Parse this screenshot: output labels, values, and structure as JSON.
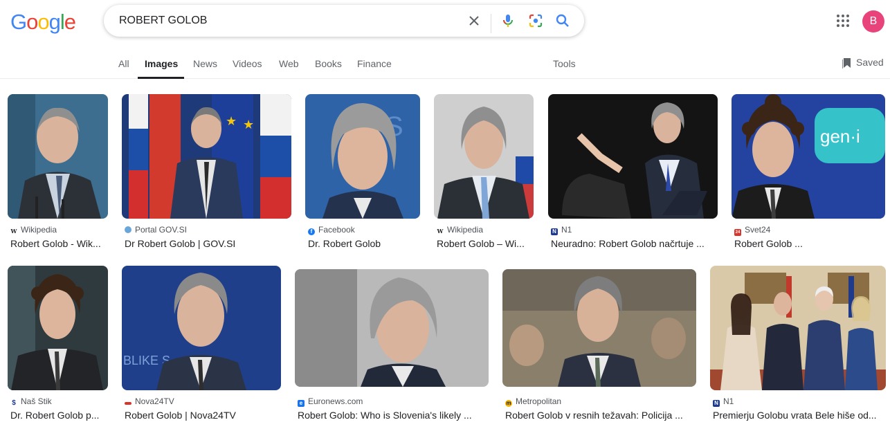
{
  "logo": {
    "letters": [
      "G",
      "o",
      "o",
      "g",
      "l",
      "e"
    ],
    "colors": [
      "#4285F4",
      "#EA4335",
      "#FBBC05",
      "#4285F4",
      "#34A853",
      "#EA4335"
    ]
  },
  "search": {
    "query": "ROBERT GOLOB"
  },
  "account": {
    "initial": "B",
    "color": "#e8437a"
  },
  "tabs": [
    "All",
    "Images",
    "News",
    "Videos",
    "Web",
    "Books",
    "Finance"
  ],
  "active_tab": "Images",
  "tools_label": "Tools",
  "saved_label": "Saved",
  "results": [
    {
      "source": "Wikipedia",
      "title": "Robert Golob - Wik...",
      "favicon": "W",
      "favcolor": "#ffffff"
    },
    {
      "source": "Portal GOV.SI",
      "title": "Dr Robert Golob | GOV.SI",
      "favicon": "",
      "favcolor": "#6aa7d8"
    },
    {
      "source": "Facebook",
      "title": "Dr. Robert Golob",
      "favicon": "f",
      "favcolor": "#1877f2"
    },
    {
      "source": "Wikipedia",
      "title": "Robert Golob – Wi...",
      "favicon": "W",
      "favcolor": "#ffffff"
    },
    {
      "source": "N1",
      "title": "Neuradno: Robert Golob načrtuje ...",
      "favicon": "N",
      "favcolor": "#1f3a8a"
    },
    {
      "source": "Svet24",
      "title": "Robert Golob ...",
      "favicon": "24",
      "favcolor": "#d9342b"
    },
    {
      "source": "Naš Stik",
      "title": "Dr. Robert Golob p...",
      "favicon": "$",
      "favcolor": "#ffffff"
    },
    {
      "source": "Nova24TV",
      "title": "Robert Golob | Nova24TV",
      "favicon": "",
      "favcolor": "#d9342b"
    },
    {
      "source": "Euronews.com",
      "title": "Robert Golob: Who is Slovenia's likely ...",
      "favicon": "e",
      "favcolor": "#1a73e8"
    },
    {
      "source": "Metropolitan",
      "title": "Robert Golob v resnih težavah: Policija ...",
      "favicon": "m",
      "favcolor": "#f4b400"
    },
    {
      "source": "N1",
      "title": "Premierju Golobu vrata Bele hiše od...",
      "favicon": "N",
      "favcolor": "#1f3a8a"
    }
  ]
}
